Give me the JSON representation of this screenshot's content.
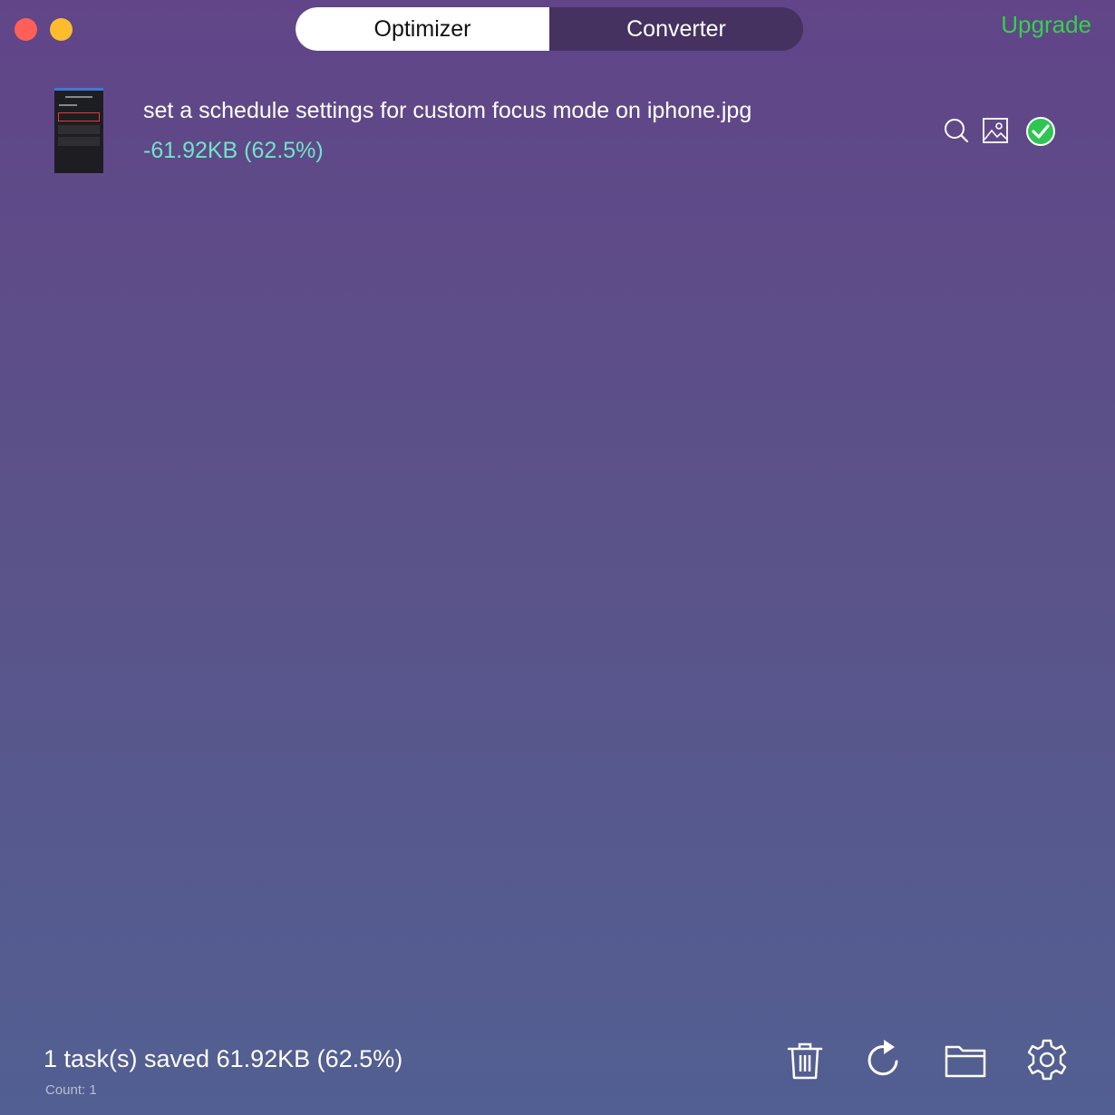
{
  "window": {
    "controls": [
      "close",
      "minimize"
    ]
  },
  "tabs": [
    {
      "label": "Optimizer",
      "active": true
    },
    {
      "label": "Converter",
      "active": false
    }
  ],
  "upgrade_label": "Upgrade",
  "files": [
    {
      "name": "set a schedule settings for custom focus mode on iphone.jpg",
      "saved": "-61.92KB (62.5%)",
      "status": "done",
      "actions": [
        "search-icon",
        "image-preview-icon",
        "check-circle-icon"
      ]
    }
  ],
  "footer": {
    "summary": "1 task(s) saved 61.92KB (62.5%)",
    "count": "Count: 1",
    "toolbar": [
      "trash-icon",
      "refresh-icon",
      "folder-icon",
      "gear-icon"
    ]
  },
  "colors": {
    "accent_green": "#35d04a",
    "saved_text": "#6ee6c5",
    "check_green": "#2fc553",
    "close": "#ff5f57",
    "minimize": "#febc2e"
  }
}
